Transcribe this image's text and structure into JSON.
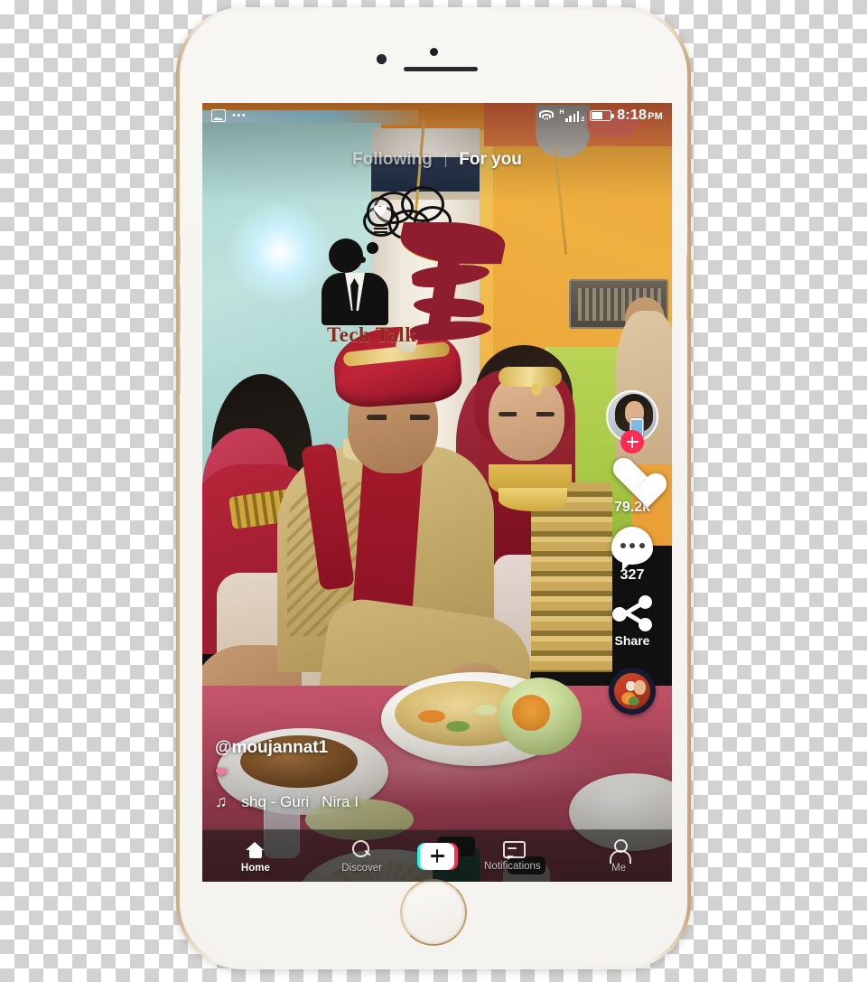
{
  "device": {
    "name": "iphone-gold-white",
    "home_button": "home-button",
    "camera": "front-camera",
    "speaker": "earpiece-speaker"
  },
  "status_bar": {
    "left_icons": [
      "image-icon",
      "more-dots-icon"
    ],
    "dots": "•••",
    "wifi": "wifi-icon",
    "network_type": "H",
    "sim_index": "2",
    "signal_bars": 4,
    "battery_level_percent": 58,
    "time": "8:18",
    "meridiem": "PM"
  },
  "tabs": {
    "following": "Following",
    "for_you": "For you",
    "active": "For you"
  },
  "watermark": {
    "brand": "Tech Talk",
    "monogram": "T²",
    "brand_color": "#8c2b1c",
    "monogram_color": "#8e1d30"
  },
  "post": {
    "username": "@moujannat1",
    "caption": "❤",
    "caption_color": "#f07a9e",
    "music_note": "♫",
    "music_title": "shq - Guri   Nira I"
  },
  "actions": {
    "follow_label": "+",
    "follow_color": "#fe2c55",
    "like_count": "79.2k",
    "comment_count": "327",
    "share_label": "Share",
    "avatar": "creator-avatar",
    "disc": "music-disc"
  },
  "nav": {
    "items": [
      {
        "label": "Home",
        "icon": "home-icon",
        "active": true
      },
      {
        "label": "Discover",
        "icon": "search-icon",
        "active": false
      },
      {
        "label": "Notifications",
        "icon": "inbox-icon",
        "active": false
      },
      {
        "label": "Me",
        "icon": "person-icon",
        "active": false
      }
    ],
    "create_label": "+",
    "create_colors": {
      "left": "#26f4ee",
      "right": "#fe2c55"
    }
  }
}
